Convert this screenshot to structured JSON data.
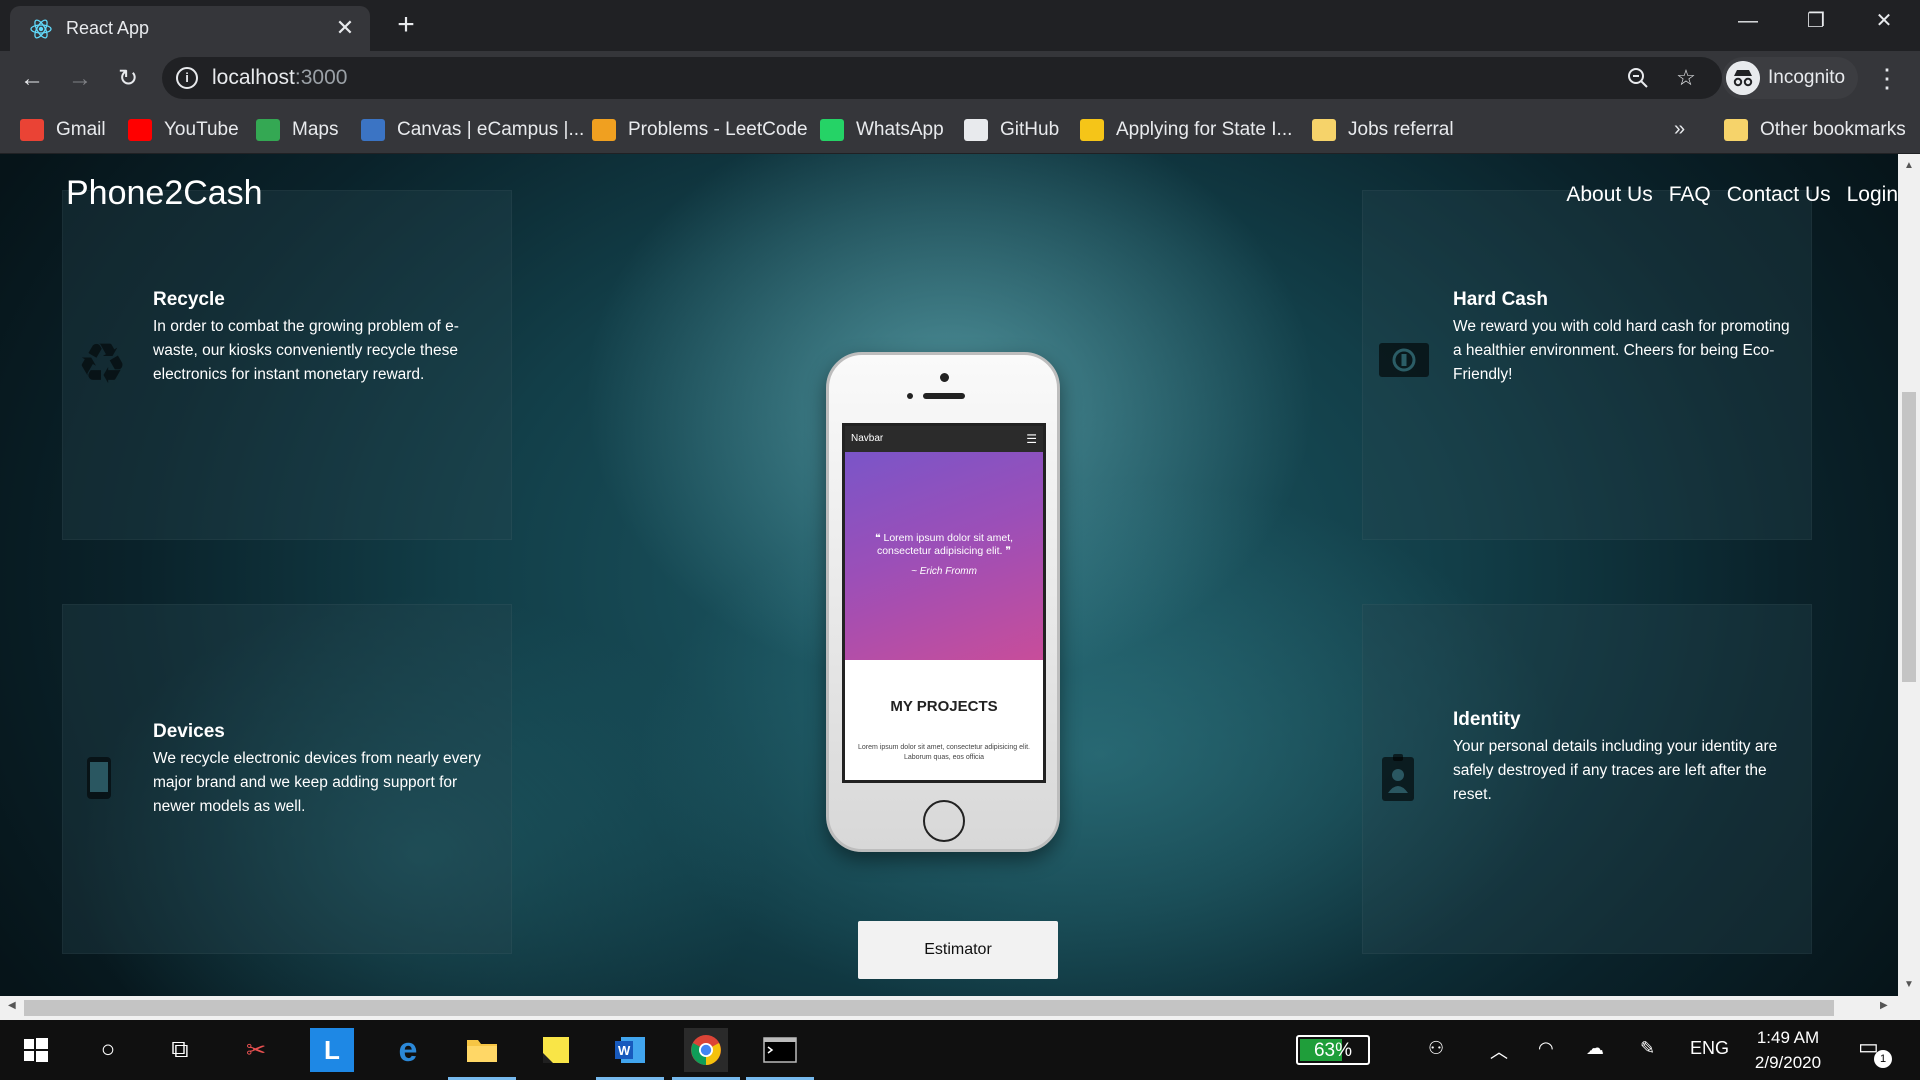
{
  "browser": {
    "tab_title": "React App",
    "tab_close": "✕",
    "new_tab": "+",
    "window_controls": {
      "minimize": "—",
      "restore": "❐",
      "close": "✕"
    },
    "url_host": "localhost",
    "url_port": ":3000",
    "incognito_label": "Incognito",
    "bookmarks": [
      {
        "label": "Gmail",
        "color": "#ea4335"
      },
      {
        "label": "YouTube",
        "color": "#ff0000"
      },
      {
        "label": "Maps",
        "color": "#34a853"
      },
      {
        "label": "Canvas | eCampus |...",
        "color": "#3b74c4"
      },
      {
        "label": "Problems - LeetCode",
        "color": "#f0a020"
      },
      {
        "label": "WhatsApp",
        "color": "#25d366"
      },
      {
        "label": "GitHub",
        "color": "#e8eaed"
      },
      {
        "label": "Applying for State I...",
        "color": "#f5c518"
      },
      {
        "label": "Jobs referral",
        "color": "#f6d36a"
      }
    ],
    "bookmarks_more": "»",
    "other_bookmarks": "Other bookmarks"
  },
  "site": {
    "brand": "Phone2Cash",
    "nav": [
      "About Us",
      "FAQ",
      "Contact Us",
      "Login"
    ],
    "cards": [
      {
        "title": "Recycle",
        "text": "In order to combat the growing problem of e-waste, our kiosks conveniently recycle these electronics for instant monetary reward.",
        "icon": "recycle-icon"
      },
      {
        "title": "Hard Cash",
        "text": "We reward you with cold hard cash for promoting a healthier environment. Cheers for being Eco-Friendly!",
        "icon": "cash-icon"
      },
      {
        "title": "Devices",
        "text": "We recycle electronic devices from nearly every major brand and we keep adding support for newer models as well.",
        "icon": "phone-icon"
      },
      {
        "title": "Identity",
        "text": "Your personal details including your identity are safely destroyed if any traces are left after the reset.",
        "icon": "id-badge-icon"
      }
    ],
    "phone_mockup": {
      "navbar": "Navbar",
      "quote": "❝ Lorem ipsum dolor sit amet, consectetur adipisicing elit. ❞",
      "author": "~ Erich Fromm",
      "section_title": "MY PROJECTS",
      "body": "Lorem ipsum dolor sit amet, consectetur adipisicing elit. Laborum quas, eos officia"
    },
    "estimator_button": "Estimator"
  },
  "taskbar": {
    "battery": "63%",
    "battery_level": 0.63,
    "language": "ENG",
    "time": "1:49 AM",
    "date": "2/9/2020",
    "notification_count": "1"
  }
}
